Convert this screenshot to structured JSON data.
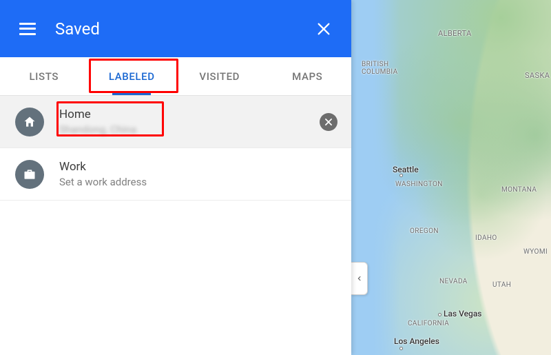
{
  "header": {
    "title": "Saved"
  },
  "tabs": [
    {
      "label": "LISTS",
      "active": false
    },
    {
      "label": "LABELED",
      "active": true
    },
    {
      "label": "VISITED",
      "active": false
    },
    {
      "label": "MAPS",
      "active": false
    }
  ],
  "labeled": [
    {
      "icon": "home-icon",
      "label": "Home",
      "sub": "Shandong, China",
      "has_clear": true,
      "sub_obscured": true
    },
    {
      "icon": "briefcase-icon",
      "label": "Work",
      "sub": "Set a work address",
      "has_clear": false,
      "sub_obscured": false
    }
  ],
  "map": {
    "regions": {
      "alberta": "ALBERTA",
      "bc": "BRITISH\nCOLUMBIA",
      "saska": "SASKA",
      "washington": "WASHINGTON",
      "oregon": "OREGON",
      "idaho": "IDAHO",
      "montana": "MONTANA",
      "nevada": "NEVADA",
      "utah": "UTAH",
      "wyoming": "WYOMI",
      "california": "CALIFORNIA"
    },
    "cities": {
      "seattle": "Seattle",
      "lasvegas": "Las Vegas",
      "losangeles": "Los Angeles"
    }
  }
}
